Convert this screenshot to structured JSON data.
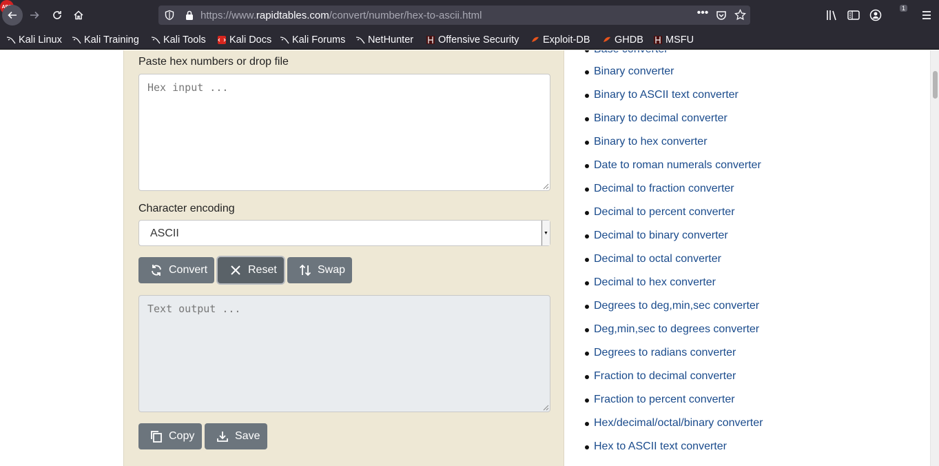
{
  "browser": {
    "url_prefix": "https://www.",
    "url_host": "rapidtables.com",
    "url_path": "/convert/number/hex-to-ascii.html",
    "more_label": "•••",
    "abp_label": "ABP",
    "abp_badge": "1"
  },
  "bookmarks": [
    {
      "label": "Kali Linux",
      "icon": "kali-dragon-icon"
    },
    {
      "label": "Kali Training",
      "icon": "kali-dragon-icon"
    },
    {
      "label": "Kali Tools",
      "icon": "kali-dragon-icon"
    },
    {
      "label": "Kali Docs",
      "icon": "kali-docs-icon"
    },
    {
      "label": "Kali Forums",
      "icon": "kali-dragon-icon"
    },
    {
      "label": "NetHunter",
      "icon": "kali-dragon-icon"
    },
    {
      "label": "Offensive Security",
      "icon": "offsec-icon"
    },
    {
      "label": "Exploit-DB",
      "icon": "exploit-db-icon"
    },
    {
      "label": "GHDB",
      "icon": "exploit-db-icon"
    },
    {
      "label": "MSFU",
      "icon": "offsec-icon"
    }
  ],
  "converter": {
    "hex_label": "Paste hex numbers or drop file",
    "hex_placeholder": "Hex input ...",
    "encoding_label": "Character encoding",
    "encoding_value": "ASCII",
    "convert_label": "Convert",
    "reset_label": "Reset",
    "swap_label": "Swap",
    "output_placeholder": "Text output ...",
    "copy_label": "Copy",
    "save_label": "Save"
  },
  "sidebar": {
    "items": [
      "Base converter",
      "Binary converter",
      "Binary to ASCII text converter",
      "Binary to decimal converter",
      "Binary to hex converter",
      "Date to roman numerals converter",
      "Decimal to fraction converter",
      "Decimal to percent converter",
      "Decimal to binary converter",
      "Decimal to octal converter",
      "Decimal to hex converter",
      "Degrees to deg,min,sec converter",
      "Deg,min,sec to degrees converter",
      "Degrees to radians converter",
      "Fraction to decimal converter",
      "Fraction to percent converter",
      "Hex/decimal/octal/binary converter",
      "Hex to ASCII text converter"
    ]
  },
  "colors": {
    "chrome": "#2b2a33",
    "panel": "#eee8d5",
    "link": "#1a4b8c",
    "button": "#6c757d"
  }
}
